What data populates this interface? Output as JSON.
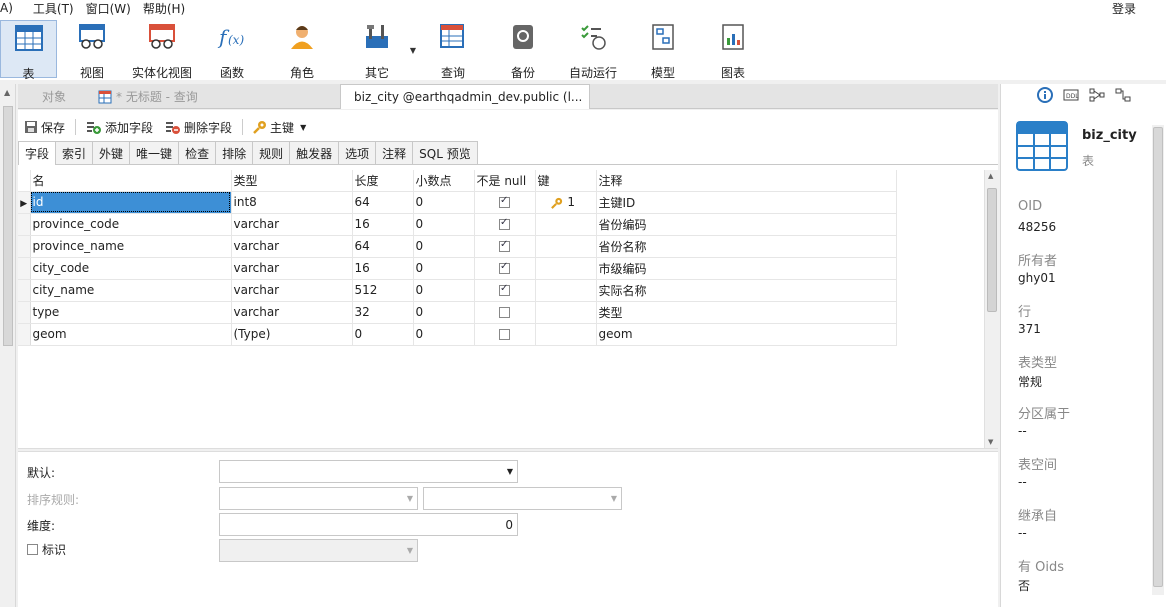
{
  "menu": {
    "items": [
      "A)",
      "工具(T)",
      "窗口(W)",
      "帮助(H)"
    ],
    "login": "登录"
  },
  "toolbar": {
    "items": [
      {
        "label": "表",
        "icon": "table-icon",
        "active": true
      },
      {
        "label": "视图",
        "icon": "view-icon"
      },
      {
        "label": "实体化视图",
        "icon": "materialized-view-icon"
      },
      {
        "label": "函数",
        "icon": "function-icon"
      },
      {
        "label": "角色",
        "icon": "role-icon"
      },
      {
        "label": "其它",
        "icon": "tools-icon"
      },
      {
        "label": "查询",
        "icon": "query-icon"
      },
      {
        "label": "备份",
        "icon": "backup-icon"
      },
      {
        "label": "自动运行",
        "icon": "automation-icon"
      },
      {
        "label": "模型",
        "icon": "model-icon"
      },
      {
        "label": "图表",
        "icon": "chart-icon"
      }
    ]
  },
  "tabs": {
    "objects": "对象",
    "untitled_query": "* 无标题 - 查询",
    "design": "biz_city @earthqadmin_dev.public (l..."
  },
  "editor_toolbar": {
    "save": "保存",
    "add_field": "添加字段",
    "delete_field": "删除字段",
    "primary_key": "主键"
  },
  "subtabs": [
    "字段",
    "索引",
    "外键",
    "唯一键",
    "检查",
    "排除",
    "规则",
    "触发器",
    "选项",
    "注释",
    "SQL 预览"
  ],
  "grid": {
    "headers": [
      "名",
      "类型",
      "长度",
      "小数点",
      "不是 null",
      "键",
      "注释"
    ],
    "rows": [
      {
        "name": "id",
        "type": "int8",
        "length": "64",
        "decimal": "0",
        "not_null": true,
        "key": "1",
        "comment": "主键ID"
      },
      {
        "name": "province_code",
        "type": "varchar",
        "length": "16",
        "decimal": "0",
        "not_null": true,
        "key": "",
        "comment": "省份编码"
      },
      {
        "name": "province_name",
        "type": "varchar",
        "length": "64",
        "decimal": "0",
        "not_null": true,
        "key": "",
        "comment": "省份名称"
      },
      {
        "name": "city_code",
        "type": "varchar",
        "length": "16",
        "decimal": "0",
        "not_null": true,
        "key": "",
        "comment": "市级编码"
      },
      {
        "name": "city_name",
        "type": "varchar",
        "length": "512",
        "decimal": "0",
        "not_null": true,
        "key": "",
        "comment": "实际名称"
      },
      {
        "name": "type",
        "type": "varchar",
        "length": "32",
        "decimal": "0",
        "not_null": false,
        "key": "",
        "comment": "类型"
      },
      {
        "name": "geom",
        "type": "(Type)",
        "length": "0",
        "decimal": "0",
        "not_null": false,
        "key": "",
        "comment": "geom"
      }
    ]
  },
  "props": {
    "default_label": "默认:",
    "collation_label": "排序规则:",
    "dimension_label": "维度:",
    "dimension_value": "0",
    "identity_label": "标识"
  },
  "info_panel": {
    "object_name": "biz_city",
    "object_type": "表",
    "fields": [
      {
        "key": "OID",
        "value": "48256"
      },
      {
        "key": "所有者",
        "value": "ghy01"
      },
      {
        "key": "行",
        "value": "371"
      },
      {
        "key": "表类型",
        "value": "常规"
      },
      {
        "key": "分区属于",
        "value": "--"
      },
      {
        "key": "表空间",
        "value": "--"
      },
      {
        "key": "继承自",
        "value": "--"
      },
      {
        "key": "有 Oids",
        "value": "否"
      }
    ]
  }
}
